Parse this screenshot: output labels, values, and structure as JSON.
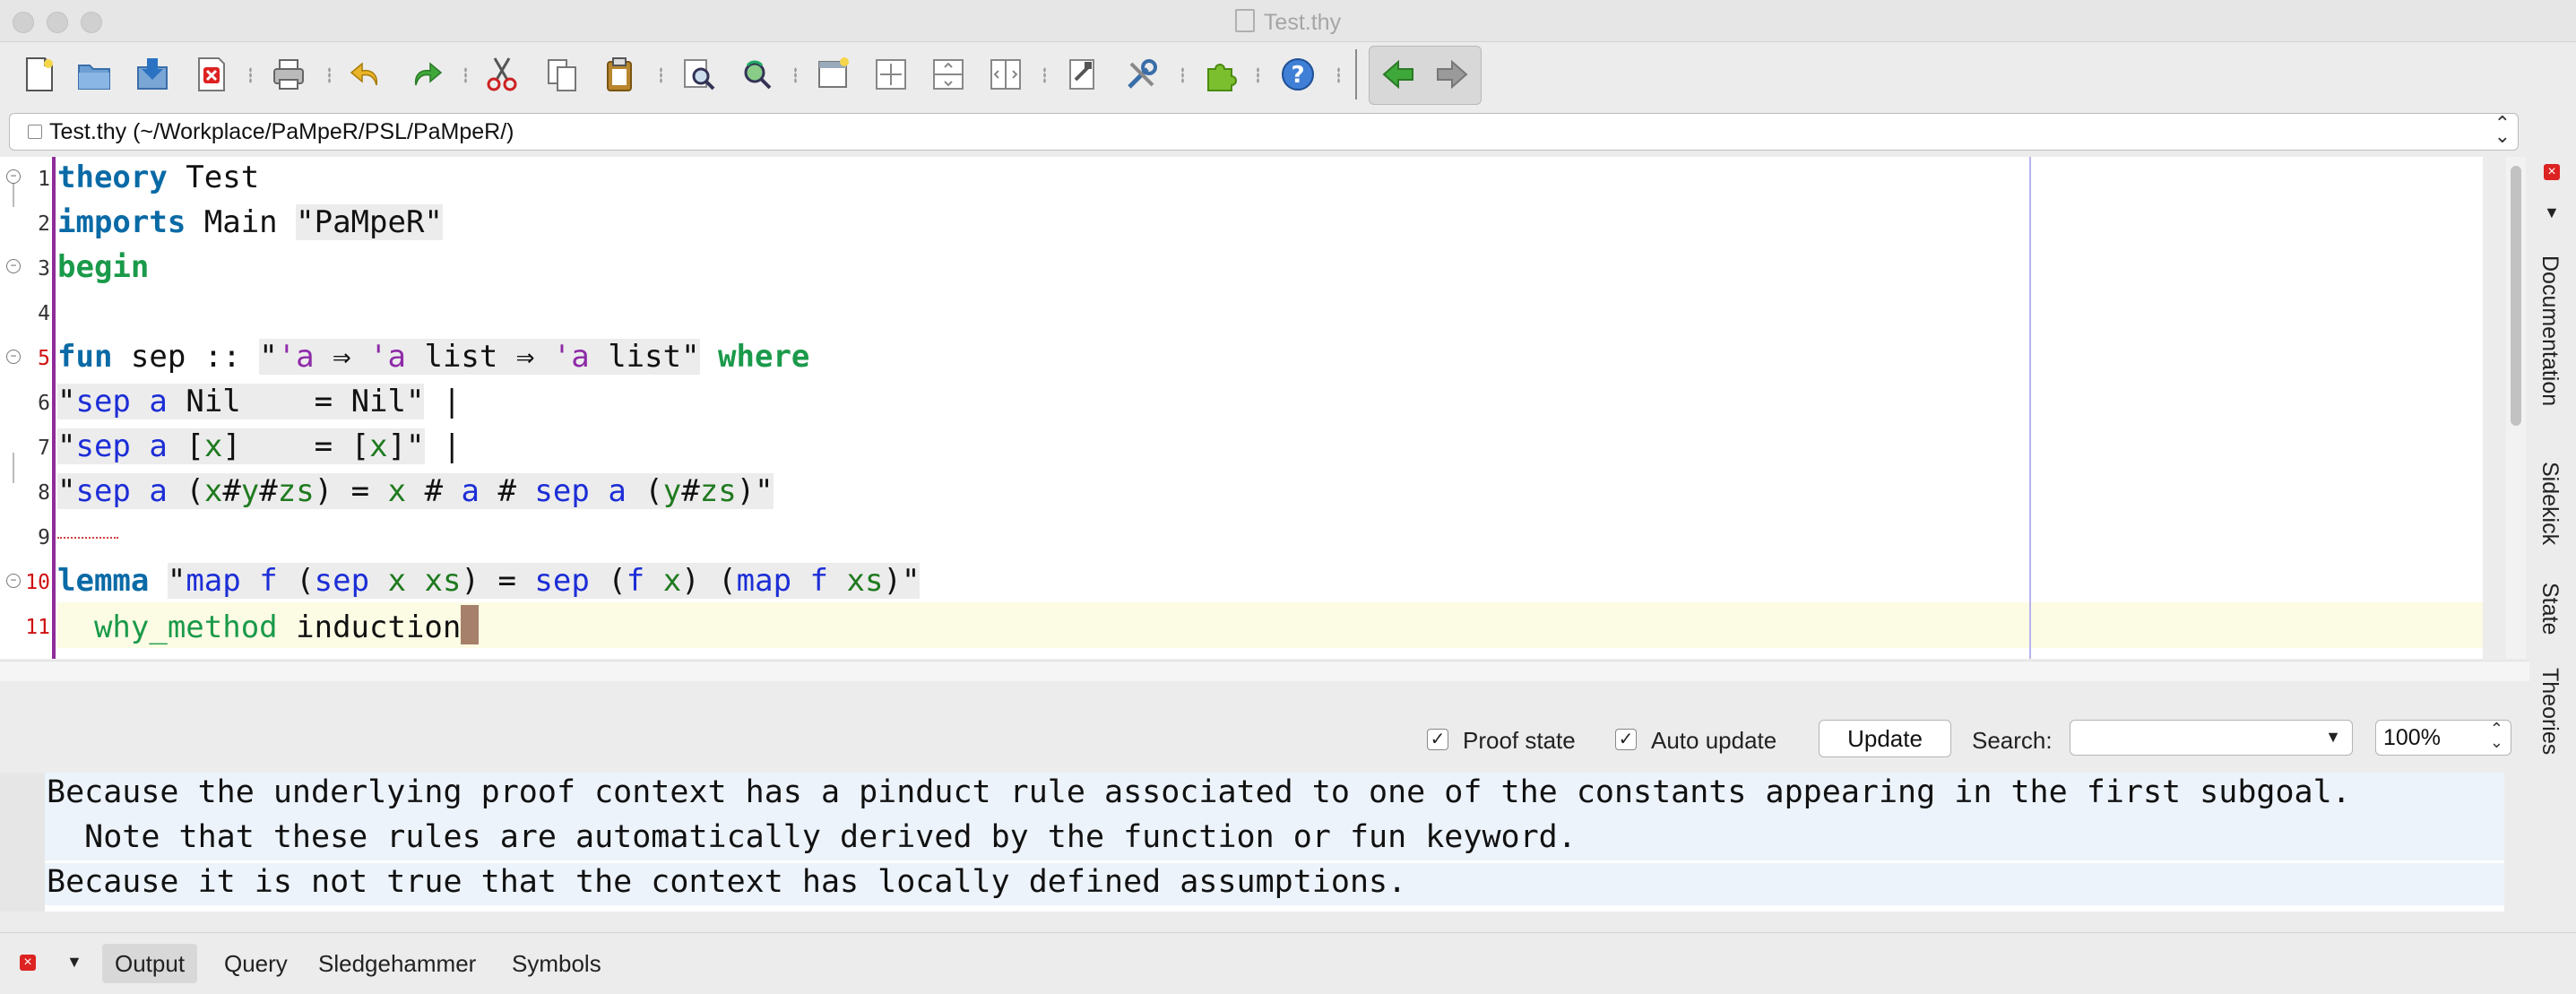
{
  "window": {
    "title": "Test.thy"
  },
  "toolbar": {
    "icons": [
      "new-file-icon",
      "open-folder-icon",
      "save-icon",
      "close-file-icon",
      "print-icon",
      "undo-icon",
      "redo-icon",
      "cut-icon",
      "copy-icon",
      "paste-icon",
      "find-icon",
      "find-replace-icon",
      "new-view-icon",
      "split-horizontal-icon",
      "split-vertical-icon",
      "unsplit-icon",
      "buffer-options-icon",
      "global-options-icon",
      "plugin-manager-icon",
      "help-icon",
      "back-icon",
      "forward-icon"
    ]
  },
  "buffer": {
    "path": "Test.thy (~/Workplace/PaMpeR/PSL/PaMpeR/)"
  },
  "editor": {
    "lines": [
      {
        "no": "1",
        "text": "theory Test"
      },
      {
        "no": "2",
        "text": "imports Main \"PaMpeR\""
      },
      {
        "no": "3",
        "text": "begin"
      },
      {
        "no": "4",
        "text": ""
      },
      {
        "no": "5",
        "text": "fun sep :: \"'a ⇒ 'a list ⇒ 'a list\" where"
      },
      {
        "no": "6",
        "text": "\"sep a Nil    = Nil\" |"
      },
      {
        "no": "7",
        "text": "\"sep a [x]    = [x]\" |"
      },
      {
        "no": "8",
        "text": "\"sep a (x#y#zs) = x # a # sep a (y#zs)\""
      },
      {
        "no": "9",
        "text": ""
      },
      {
        "no": "10",
        "text": "lemma \"map f (sep x xs) = sep (f x) (map f xs)\""
      },
      {
        "no": "11",
        "text": "  why_method induction"
      }
    ]
  },
  "side_tabs": [
    "Documentation",
    "Sidekick",
    "State",
    "Theories"
  ],
  "output_options": {
    "proof_state_label": "Proof state",
    "proof_state_checked": true,
    "auto_update_label": "Auto update",
    "auto_update_checked": true,
    "update_button": "Update",
    "search_label": "Search:",
    "search_value": "",
    "zoom": "100%"
  },
  "output": {
    "messages": [
      "Because the underlying proof context has a pinduct rule associated to one of the constants appearing in the first subgoal.",
      "  Note that these rules are automatically derived by the function or fun keyword.",
      "Because it is not true that the context has locally defined assumptions."
    ]
  },
  "bottom_tabs": [
    "Output",
    "Query",
    "Sledgehammer",
    "Symbols"
  ],
  "colors": {
    "keyword": "#0a6aa6",
    "command": "#1a9a4a",
    "free_var": "#1c2ed6",
    "bound_var": "#1f7a1f",
    "type_var": "#8e2aa8",
    "error": "#d01010"
  }
}
